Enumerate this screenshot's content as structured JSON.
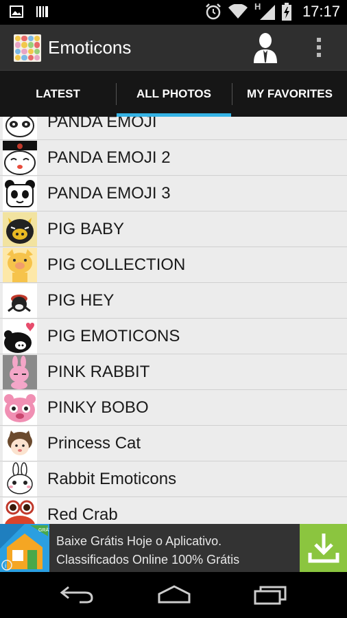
{
  "status_bar": {
    "time": "17:17",
    "network_label": "H",
    "icons": [
      "image-icon",
      "barcode-icon",
      "alarm-icon",
      "wifi-icon",
      "signal-icon",
      "battery-charging-icon"
    ]
  },
  "app": {
    "title": "Emoticons"
  },
  "tabs": [
    {
      "label": "LATEST",
      "selected": false
    },
    {
      "label": "ALL PHOTOS",
      "selected": true
    },
    {
      "label": "MY FAVORITES",
      "selected": false
    }
  ],
  "list": {
    "items": [
      {
        "label": "PANDA EMOJI"
      },
      {
        "label": "PANDA EMOJI 2"
      },
      {
        "label": "PANDA EMOJI 3"
      },
      {
        "label": "PIG BABY"
      },
      {
        "label": "PIG COLLECTION"
      },
      {
        "label": "PIG HEY"
      },
      {
        "label": "PIG EMOTICONS"
      },
      {
        "label": "PINK RABBIT"
      },
      {
        "label": "PINKY BOBO"
      },
      {
        "label": "Princess Cat"
      },
      {
        "label": "Rabbit Emoticons"
      },
      {
        "label": "Red Crab"
      }
    ]
  },
  "ad": {
    "line1": "Baixe Grátis Hoje o Aplicativo.",
    "line2": "Classificados Online 100% Grátis",
    "badge": "GRÁTIS"
  },
  "colors": {
    "tab_indicator": "#35b3e5",
    "ad_button": "#8bc53f",
    "action_bar": "#2f2f2f"
  }
}
